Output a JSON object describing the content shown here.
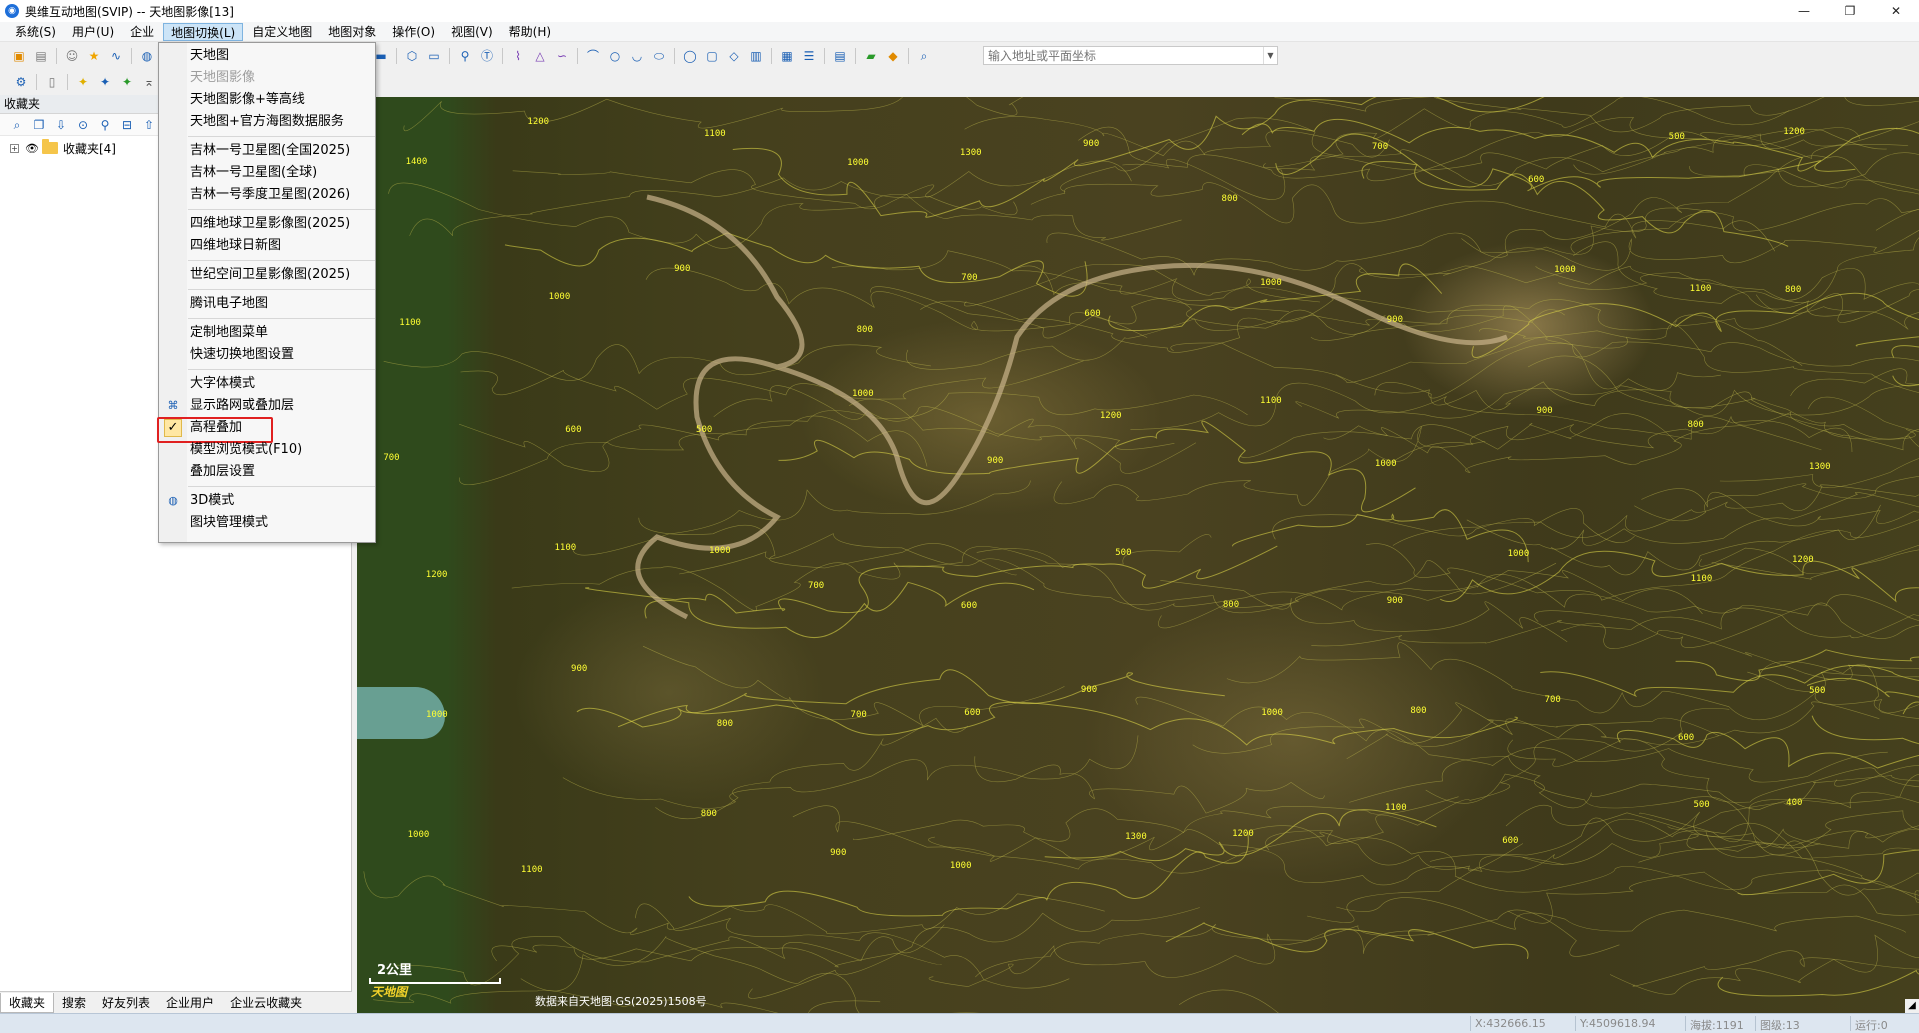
{
  "window": {
    "title": "奥维互动地图(SVIP) -- 天地图影像[13]",
    "minimize": "—",
    "maximize": "❐",
    "close": "✕"
  },
  "menubar": {
    "items": [
      {
        "label": "系统(S)"
      },
      {
        "label": "用户(U)"
      },
      {
        "label": "企业"
      },
      {
        "label": "地图切换(L)"
      },
      {
        "label": "自定义地图"
      },
      {
        "label": "地图对象"
      },
      {
        "label": "操作(O)"
      },
      {
        "label": "视图(V)"
      },
      {
        "label": "帮助(H)"
      }
    ]
  },
  "toolbar": {
    "search_placeholder": "输入地址或平面坐标"
  },
  "left_panel": {
    "header": "收藏夹",
    "tree_root_expander": "+",
    "tree_root_label": "收藏夹[4]",
    "tabs": [
      {
        "label": "收藏夹"
      },
      {
        "label": "搜索"
      },
      {
        "label": "好友列表"
      },
      {
        "label": "企业用户"
      },
      {
        "label": "企业云收藏夹"
      }
    ]
  },
  "dropdown": {
    "items": [
      {
        "label": "天地图"
      },
      {
        "label": "天地图影像"
      },
      {
        "label": "天地图影像+等高线"
      },
      {
        "label": "天地图+官方海图数据服务"
      },
      {
        "label": "吉林一号卫星图(全国2025)"
      },
      {
        "label": "吉林一号卫星图(全球)"
      },
      {
        "label": "吉林一号季度卫星图(2026)"
      },
      {
        "label": "四维地球卫星影像图(2025)"
      },
      {
        "label": "四维地球日新图"
      },
      {
        "label": "世纪空间卫星影像图(2025)"
      },
      {
        "label": "腾讯电子地图"
      },
      {
        "label": "定制地图菜单"
      },
      {
        "label": "快速切换地图设置"
      },
      {
        "label": "大字体模式"
      },
      {
        "label": "显示路网或叠加层"
      },
      {
        "label": "高程叠加",
        "check": "✓"
      },
      {
        "label": "模型浏览模式(F10)"
      },
      {
        "label": "叠加层设置"
      },
      {
        "label": "3D模式"
      },
      {
        "label": "图块管理模式"
      }
    ]
  },
  "map": {
    "scale_label": "2公里",
    "logo": "天地图",
    "attribution": "数据来自天地图·GS(2025)1508号",
    "contour_labels": [
      "1400",
      "1200",
      "1100",
      "1000",
      "1300",
      "900",
      "800",
      "700",
      "600",
      "500",
      "1200",
      "1100",
      "1000",
      "900",
      "800",
      "700",
      "600",
      "1000",
      "900",
      "1000",
      "1100",
      "800",
      "700",
      "600",
      "500",
      "1000",
      "900",
      "1200",
      "1100",
      "1000",
      "900",
      "800",
      "1300",
      "1200",
      "1100",
      "1000",
      "700",
      "600",
      "500",
      "800",
      "900",
      "1000",
      "1100",
      "1200",
      "1000",
      "900",
      "800",
      "700",
      "600",
      "900",
      "1000",
      "800",
      "700",
      "600",
      "500",
      "1000",
      "1100",
      "800",
      "900",
      "1000",
      "1300",
      "1200",
      "1100",
      "600",
      "500",
      "400"
    ]
  },
  "statusbar": {
    "x": "X:432666.15",
    "y": "Y:4509618.94",
    "elevation": "海拔:1191",
    "level": "图级:13",
    "run": "运行:0"
  }
}
